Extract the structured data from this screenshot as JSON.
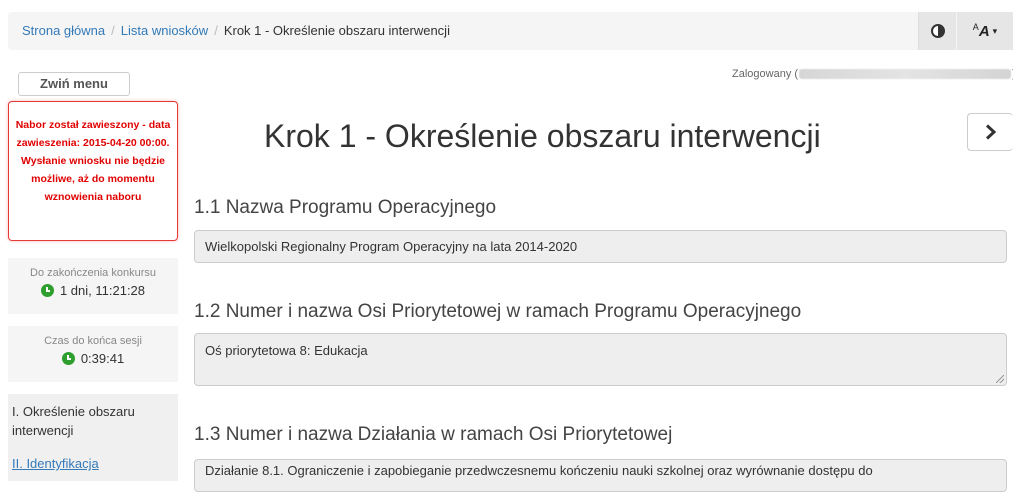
{
  "breadcrumb": {
    "home": "Strona główna",
    "list": "Lista wniosków",
    "current": "Krok 1 - Określenie obszaru interwencji",
    "separator": "/"
  },
  "toolbar": {
    "contrast_icon": "contrast-icon",
    "font_size_icon": "font-size-icon"
  },
  "sidebar": {
    "collapse_label": "Zwiń menu",
    "alert_text": "Nabor został zawieszony - data zawieszenia: 2015-04-20 00:00. Wysłanie wniosku nie będzie możliwe, aż do momentu wznowienia naboru",
    "contest_end_label": "Do zakończenia konkursu",
    "contest_end_value": "1 dni, 11:21:28",
    "session_label": "Czas do końca sesji",
    "session_value": "0:39:41",
    "nav_items": [
      "I. Określenie obszaru interwencji",
      "II. Identyfikacja"
    ]
  },
  "header": {
    "logged_prefix": "Zalogowany (",
    "logged_suffix": ")"
  },
  "main": {
    "title": "Krok 1 - Określenie obszaru interwencji",
    "sections": [
      {
        "label": "1.1 Nazwa Programu Operacyjnego",
        "value": "Wielkopolski Regionalny Program Operacyjny na lata 2014-2020"
      },
      {
        "label": "1.2 Numer i nazwa Osi Priorytetowej w ramach Programu Operacyjnego",
        "value": "Oś priorytetowa 8: Edukacja"
      },
      {
        "label": "1.3 Numer i nazwa Działania w ramach Osi Priorytetowej",
        "value": "Działanie 8.1. Ograniczenie i zapobieganie przedwczesnemu kończeniu nauki szkolnej oraz wyrównanie dostępu do"
      }
    ]
  },
  "colors": {
    "link": "#337ab7",
    "alert": "#e00000",
    "clock": "#2e9e2e"
  }
}
